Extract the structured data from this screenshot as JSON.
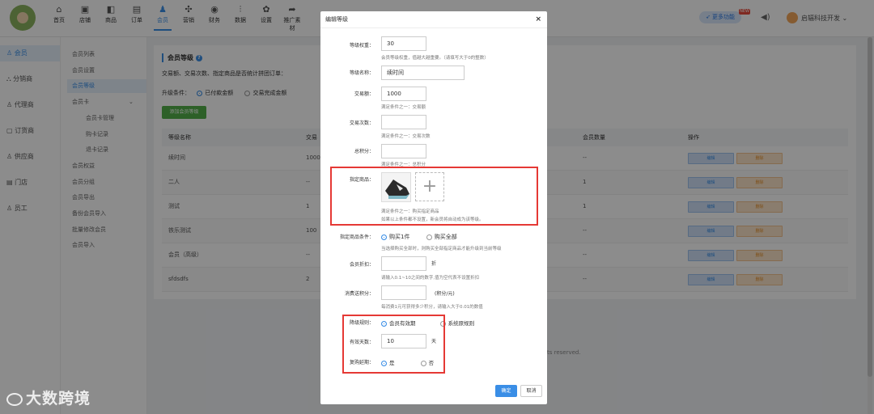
{
  "topbar": {
    "nav": [
      {
        "icon": "home-icon",
        "glyph": "⌂",
        "label": "首页"
      },
      {
        "icon": "store-icon",
        "glyph": "▣",
        "label": "店铺"
      },
      {
        "icon": "goods-icon",
        "glyph": "◧",
        "label": "商品"
      },
      {
        "icon": "order-icon",
        "glyph": "▤",
        "label": "订单"
      },
      {
        "icon": "member-icon",
        "glyph": "♟",
        "label": "会员",
        "active": true
      },
      {
        "icon": "marketing-icon",
        "glyph": "✣",
        "label": "营销"
      },
      {
        "icon": "finance-icon",
        "glyph": "◉",
        "label": "财务"
      },
      {
        "icon": "data-icon",
        "glyph": "⫶",
        "label": "数据"
      },
      {
        "icon": "settings-icon",
        "glyph": "✿",
        "label": "设置"
      },
      {
        "icon": "promote-icon",
        "glyph": "➦",
        "label": "推广素材"
      }
    ],
    "more_features": "更多功能",
    "new_badge": "NEW",
    "user_name": "启辐科技开发"
  },
  "sidebar_primary": [
    "会员",
    "分销商",
    "代理商",
    "订货商",
    "供应商",
    "门店",
    "员工"
  ],
  "sidebar_secondary": {
    "items": [
      "会员列表",
      "会员设置",
      "会员等级",
      "会员卡",
      "会员卡管理",
      "购卡记录",
      "退卡记录",
      "会员权益",
      "会员分组",
      "会员导出",
      "备份会员导入",
      "批量修改会员",
      "会员导入"
    ]
  },
  "main": {
    "section_title": "会员等级",
    "line1": "交易额、交易次数、指定商品是否统计拼团订单：",
    "upgrade_label": "升级条件：",
    "upgrade_opt1": "已付款金额",
    "upgrade_opt2": "交易完成金额",
    "add_button": "添加会员等级",
    "table": {
      "headers": {
        "name": "等级名称",
        "amount": "交易",
        "count": "会员数量",
        "ops": "操作"
      },
      "rows": [
        {
          "name": "续时间",
          "amount": "1000",
          "count": "--"
        },
        {
          "name": "二人",
          "amount": "--",
          "count": "1"
        },
        {
          "name": "测试",
          "amount": "1",
          "count": "1"
        },
        {
          "name": "铁乐测试",
          "amount": "100",
          "count": "--"
        },
        {
          "name": "会员（高级）",
          "amount": "--",
          "count": "--"
        },
        {
          "name": "sfdsdfs",
          "amount": "2",
          "count": "--"
        }
      ],
      "edit_label": "编辑",
      "delete_label": "删除"
    },
    "rights": "ts reserved."
  },
  "modal": {
    "title": "编辑等级",
    "weight_label": "等级权重：",
    "weight_value": "30",
    "weight_hint": "会员等级权重，值越大越重要。（请填写大于0的整数）",
    "name_label": "等级名称：",
    "name_value": "续时间",
    "amount_label": "交易额：",
    "amount_value": "1000",
    "amount_hint": "满足条件之一：交易额",
    "count_label": "交易次数：",
    "count_value": "",
    "count_hint": "满足条件之一：交易次数",
    "points_label": "总积分：",
    "points_value": "",
    "points_hint": "满足条件之一：总积分",
    "goods_label": "指定商品：",
    "goods_hint1": "满足条件之一：购买指定商品",
    "goods_hint2": "如果以上条件都不设置，新会员将自动成为该等级。",
    "goods_cond_label": "指定商品条件：",
    "goods_cond_opt1": "购买1件",
    "goods_cond_opt2": "购买全部",
    "goods_cond_hint": "当选择购买全部时，则购买全部指定商品才能升级到当前等级",
    "discount_label": "会员折扣：",
    "discount_value": "",
    "discount_unit": "折",
    "discount_hint": "请输入0.1~10之间的数字,值为空代表不设置折扣",
    "consume_label": "消费送积分：",
    "consume_value": "",
    "consume_unit": "(积分/元)",
    "consume_hint": "每消费1元可获得多少积分，请输入大于0.01的数值",
    "downgrade_label": "降级规则：",
    "downgrade_opt1": "会员有效期",
    "downgrade_opt2": "系统原规则",
    "valid_label": "有效天数：",
    "valid_value": "10",
    "valid_unit": "天",
    "extend_label": "复购延期：",
    "extend_yes": "是",
    "extend_no": "否",
    "ok": "确定",
    "cancel": "取消"
  },
  "watermark": "大数跨境"
}
